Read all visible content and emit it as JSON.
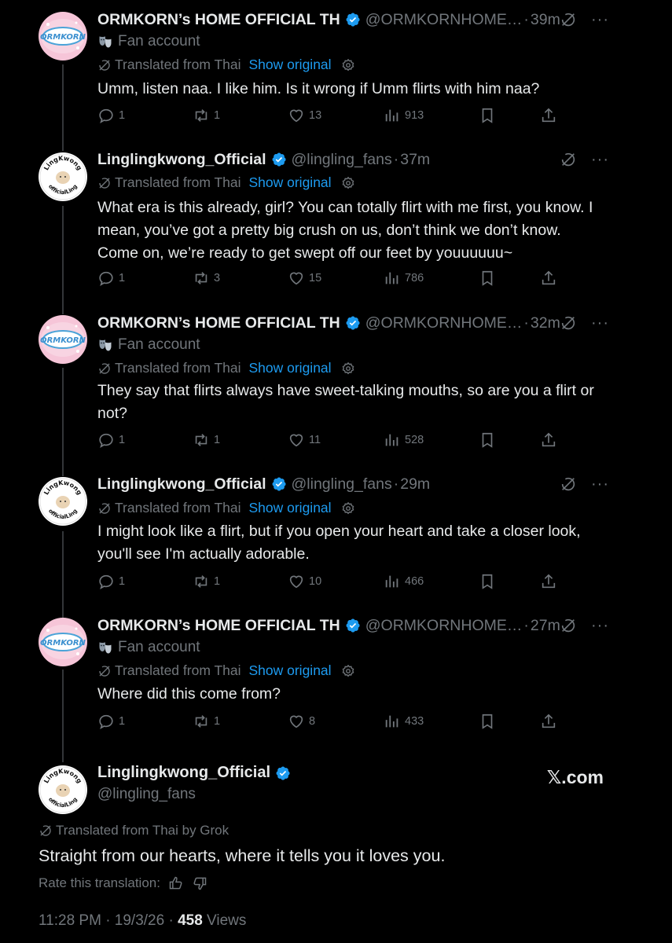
{
  "colors": {
    "background": "#000000",
    "text": "#e7e9ea",
    "muted": "#71767b",
    "link": "#1d9bf0",
    "verified": "#1d9bf0"
  },
  "accounts": {
    "ormkorn": {
      "name": "ORMKORN’s HOME OFFICIAL TH",
      "handle": "@ORMKORNHOME…",
      "label": "Fan account",
      "label_icon": "theater-masks-icon",
      "avatar_text": "ORMKORN"
    },
    "lingling": {
      "name": "Linglingkwong_Official",
      "handle": "@lingling_fans",
      "avatar_text": "Lingkwong officialLing"
    }
  },
  "translation": {
    "translated_from": "Translated from Thai",
    "show_original": "Show original"
  },
  "replies": [
    {
      "time": "39m",
      "text": "Umm, listen naa. I like him. Is it wrong if Umm flirts with him naa?",
      "replies": "1",
      "reposts": "1",
      "likes": "13",
      "views": "913"
    },
    {
      "time": "37m",
      "text": "What era is this already, girl? You can totally flirt with me first, you know. I mean, you’ve got a pretty big crush on us, don’t think we don’t know. Come on, we’re ready to get swept off our feet by youuuuuu~",
      "replies": "1",
      "reposts": "3",
      "likes": "15",
      "views": "786"
    },
    {
      "time": "32m",
      "text": "They say that flirts always have sweet-talking mouths, so are you a flirt or not?",
      "replies": "1",
      "reposts": "1",
      "likes": "11",
      "views": "528"
    },
    {
      "time": "29m",
      "text": "I might look like a flirt, but if you open your heart and take a closer look, you'll see I'm actually adorable.",
      "replies": "1",
      "reposts": "1",
      "likes": "10",
      "views": "466"
    },
    {
      "time": "27m",
      "text": "Where did this come from?",
      "replies": "1",
      "reposts": "1",
      "likes": "8",
      "views": "433"
    }
  ],
  "main_tweet": {
    "name": "Linglingkwong_Official",
    "handle": "@lingling_fans",
    "site": "𝕏.com",
    "translated": "Translated from Thai by Grok",
    "text": "Straight from our hearts, where it tells you it loves you.",
    "rate": "Rate this translation:",
    "timestamp": "11:28 PM · 19/3/26 · ",
    "views_count": "458",
    "views_label": " Views"
  }
}
